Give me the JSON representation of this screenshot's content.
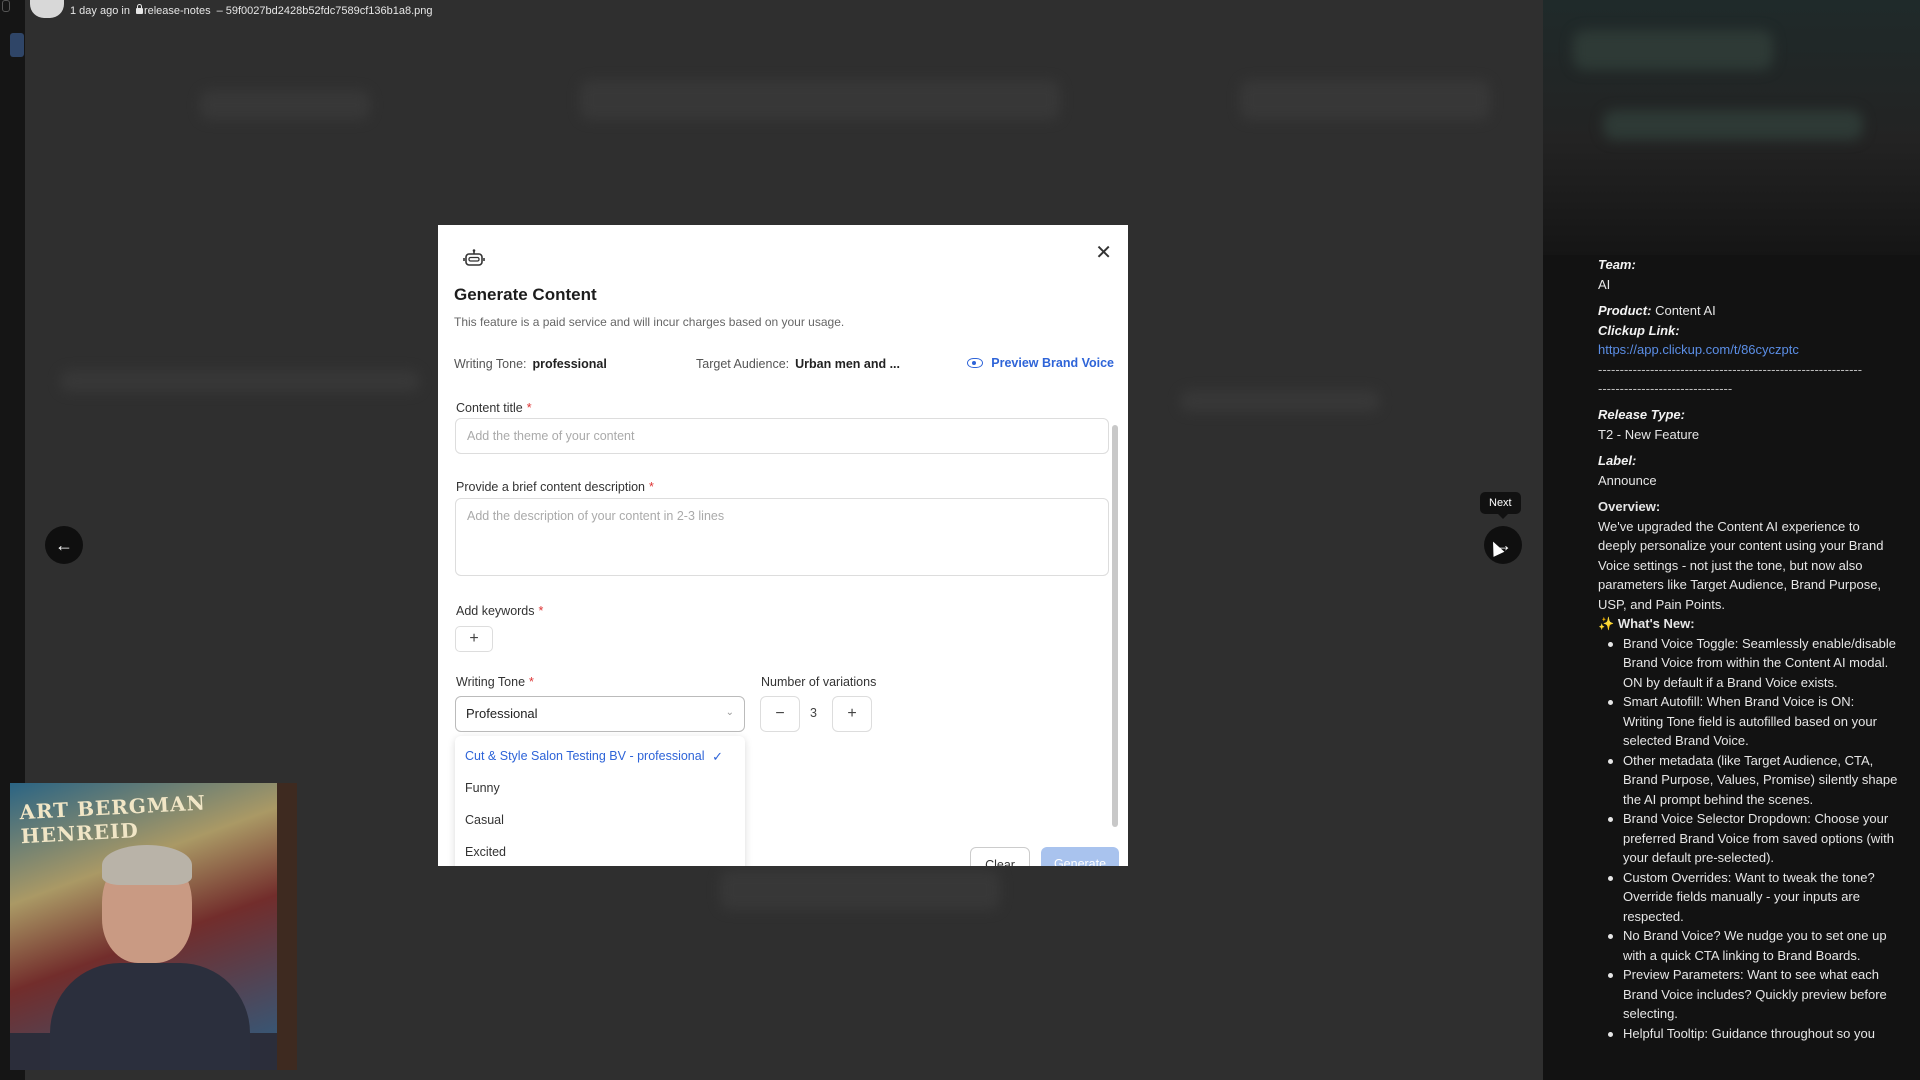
{
  "topbar": {
    "time_text": "1 day ago in",
    "channel": "release-notes",
    "filename": "– 59f0027bd2428b52fdc7589cf136b1a8.png"
  },
  "viewer": {
    "prev_icon": "arrow-left-icon",
    "next_icon": "arrow-right-icon",
    "next_tooltip": "Next"
  },
  "modal": {
    "icon": "robot-icon",
    "title": "Generate Content",
    "subtitle": "This feature is a paid service and will incur charges based on your usage.",
    "writing_tone_label": "Writing Tone:",
    "writing_tone_value": "professional",
    "target_audience_label": "Target Audience:",
    "target_audience_value": "Urban men and ...",
    "preview_brand_voice": "Preview Brand Voice",
    "content_title_label": "Content title",
    "content_title_placeholder": "Add the theme of your content",
    "description_label": "Provide a brief content description",
    "description_placeholder": "Add the description of your content in 2-3 lines",
    "keywords_label": "Add keywords",
    "tone_label": "Writing Tone",
    "tone_selected": "Professional",
    "variations_label": "Number of variations",
    "variations_count": "3",
    "tone_options": [
      "Cut & Style Salon Testing BV - professional",
      "Funny",
      "Casual",
      "Excited"
    ],
    "clear_label": "Clear",
    "generate_label": "Generate",
    "required_mark": "*",
    "close_symbol": "✕",
    "plus_symbol": "+",
    "minus_symbol": "−",
    "check_symbol": "✓",
    "chevron_symbol": "⌄"
  },
  "right_panel": {
    "team_label": "Team:",
    "team_value": "AI",
    "product_label": "Product:",
    "product_value": "Content AI",
    "clickup_label": "Clickup Link:",
    "clickup_url": "https://app.clickup.com/t/86cyczptc",
    "dashes_1": "-------------------------------------------------------------",
    "dashes_2": "-------------------------------",
    "release_type_label": "Release Type:",
    "release_type_value": "T2 - New Feature",
    "label_label": "Label:",
    "label_value": "Announce",
    "overview_label": "Overview:",
    "overview_text": "We've upgraded the Content AI experience to deeply personalize your content using your Brand Voice settings - not just the tone, but now also parameters like Target Audience, Brand Purpose, USP, and Pain Points.",
    "whats_new_icon": "sparkles-icon",
    "whats_new_glyph": "✨",
    "whats_new_label": "What's New:",
    "bullets": [
      "Brand Voice Toggle: Seamlessly enable/disable Brand Voice from within the Content AI modal. ON by default if a Brand Voice exists.",
      "Smart Autofill: When Brand Voice is ON: Writing Tone field is autofilled based on your selected Brand Voice.",
      "Other metadata (like Target Audience, CTA, Brand Purpose, Values, Promise) silently shape the AI prompt behind the scenes.",
      "Brand Voice Selector Dropdown: Choose your preferred Brand Voice from saved options (with your default pre-selected).",
      "Custom Overrides: Want to tweak the tone? Override fields manually - your inputs are respected.",
      "No Brand Voice? We nudge you to set one up with a quick CTA linking to Brand Boards.",
      "Preview Parameters: Want to see what each Brand Voice includes? Quickly preview before selecting.",
      "Helpful Tooltip: Guidance throughout so you"
    ]
  },
  "webcam": {
    "poster_text": "ART BERGMAN HENREID"
  }
}
